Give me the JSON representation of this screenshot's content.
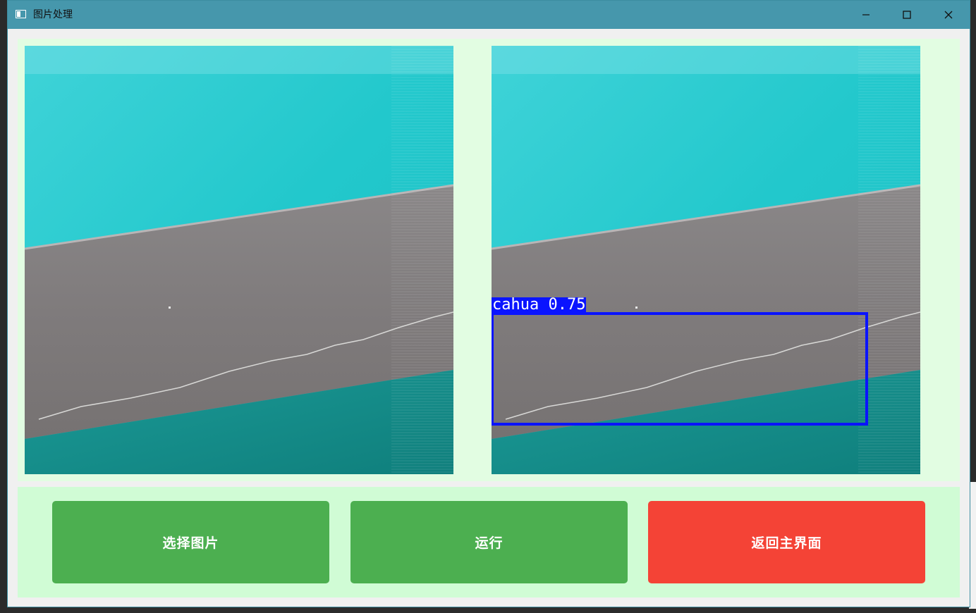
{
  "window": {
    "title": "图片处理",
    "controls": [
      "minimize-icon",
      "maximize-icon",
      "close-icon"
    ]
  },
  "images": {
    "original": {
      "icon": "image"
    },
    "result": {
      "icon": "image",
      "detection": {
        "label": "cahua 0.75",
        "box_color": "#0a14ff"
      }
    }
  },
  "buttons": {
    "select_image": "选择图片",
    "run": "运行",
    "back_home": "返回主界面"
  },
  "colors": {
    "titlebar": "#4697ac",
    "image_panel": "#e2fde2",
    "button_panel": "#d0fcd5",
    "green_button": "#4caf50",
    "red_button": "#f44336"
  }
}
